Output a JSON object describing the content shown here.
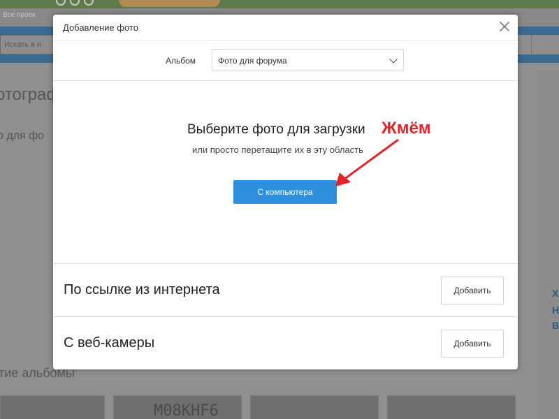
{
  "background": {
    "nav_text": "Все проек",
    "search_placeholder": "Искать в н",
    "heading": "отографи",
    "subheading": "о для фо",
    "albums_heading": "тие альбомы",
    "thumb_text": "M08KHF6",
    "right_letters": [
      "Х",
      "Н",
      "В"
    ]
  },
  "modal": {
    "title": "Добавление фото",
    "album_label": "Альбом",
    "album_selected": "Фото для форума",
    "upload_title": "Выберите фото для загрузки",
    "upload_subtitle": "или просто перетащите их в эту область",
    "computer_button": "С компьютера",
    "link_label": "По ссылке из интернета",
    "link_add_button": "Добавить",
    "webcam_label": "С веб-камеры",
    "webcam_add_button": "Добавить"
  },
  "annotation": {
    "text": "Жмём",
    "color": "#e0242a"
  },
  "colors": {
    "primary_button": "#2f8fdf"
  }
}
